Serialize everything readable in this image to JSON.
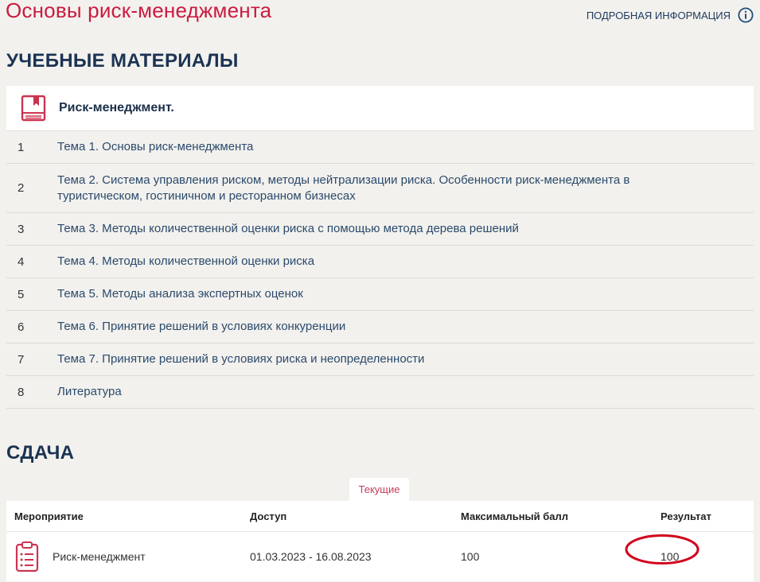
{
  "header": {
    "title": "Основы риск-менеджмента",
    "info_link": "ПОДРОБНАЯ ИНФОРМАЦИЯ",
    "info_icon": "info-circle-icon"
  },
  "materials": {
    "heading": "УЧЕБНЫЕ МАТЕРИАЛЫ",
    "course": {
      "icon": "book-icon",
      "name": "Риск-менеджмент."
    },
    "topics": [
      {
        "num": "1",
        "title": "Тема 1. Основы риск-менеджмента"
      },
      {
        "num": "2",
        "title": "Тема 2. Система управления риском, методы нейтрализации риска. Особенности риск-менеджмента в туристическом, гостиничном и ресторанном бизнесах"
      },
      {
        "num": "3",
        "title": "Тема 3. Методы количественной оценки риска с помощью метода дерева решений"
      },
      {
        "num": "4",
        "title": "Тема 4. Методы количественной оценки риска"
      },
      {
        "num": "5",
        "title": "Тема 5. Методы анализа экспертных оценок"
      },
      {
        "num": "6",
        "title": "Тема 6. Принятие решений в условиях конкуренции"
      },
      {
        "num": "7",
        "title": "Тема 7. Принятие решений в условиях риска и неопределенности"
      },
      {
        "num": "8",
        "title": "Литература"
      }
    ]
  },
  "submission": {
    "heading": "СДАЧА",
    "tab_current": "Текущие",
    "columns": [
      "Мероприятие",
      "Доступ",
      "Максимальный балл",
      "Результат"
    ],
    "rows": [
      {
        "icon": "clipboard-list-icon",
        "event": "Риск-менеджмент",
        "access": "01.03.2023 - 16.08.2023",
        "max_score": "100",
        "result": "100"
      }
    ]
  },
  "colors": {
    "brand_red": "#cc1a3f",
    "navy": "#1b3352",
    "background": "#f2f1ee",
    "annotation_red": "#d0021b"
  }
}
